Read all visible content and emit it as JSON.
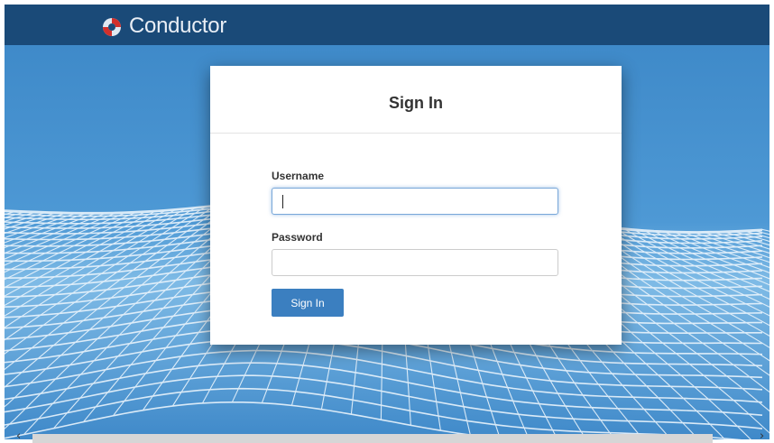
{
  "header": {
    "brand": "Conductor",
    "logo_icon": "conductor-swirl-logo",
    "background_color": "#1a4a78"
  },
  "login": {
    "title": "Sign In",
    "username_label": "Username",
    "username_value": "",
    "password_label": "Password",
    "password_value": "",
    "submit_label": "Sign In",
    "button_color": "#3b7fc0"
  },
  "scrollbar": {
    "left_icon": "chevron-left-icon",
    "right_icon": "chevron-right-icon",
    "left_glyph": "‹",
    "right_glyph": "›"
  }
}
